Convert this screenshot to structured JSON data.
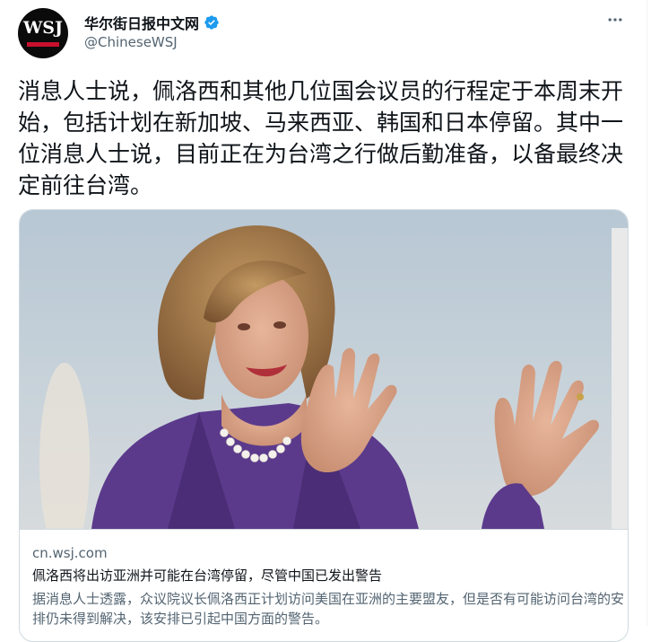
{
  "account": {
    "display_name": "华尔街日报中文网",
    "handle": "@ChineseWSJ",
    "avatar_logo": "WSJ",
    "verified_icon": "verified-badge-icon"
  },
  "tweet": {
    "text": "消息人士说，佩洛西和其他几位国会议员的行程定于本周末开始，包括计划在新加坡、马来西亚、韩国和日本停留。其中一位消息人士说，目前正在为台湾之行做后勤准备，以备最终决定前往台湾。",
    "more_icon": "more-icon"
  },
  "card": {
    "domain": "cn.wsj.com",
    "title": "佩洛西将出访亚洲并可能在台湾停留，尽管中国已发出警告",
    "description": "据消息人士透露，众议院议长佩洛西正计划访问美国在亚洲的主要盟友，但是否有可能访问台湾的安排仍未得到解决，该安排已引起中国方面的警告。"
  },
  "colors": {
    "verified_blue": "#1d9bf0",
    "wsj_red": "#c8102e",
    "secondary_text": "#536471",
    "border": "#cfd9de"
  }
}
